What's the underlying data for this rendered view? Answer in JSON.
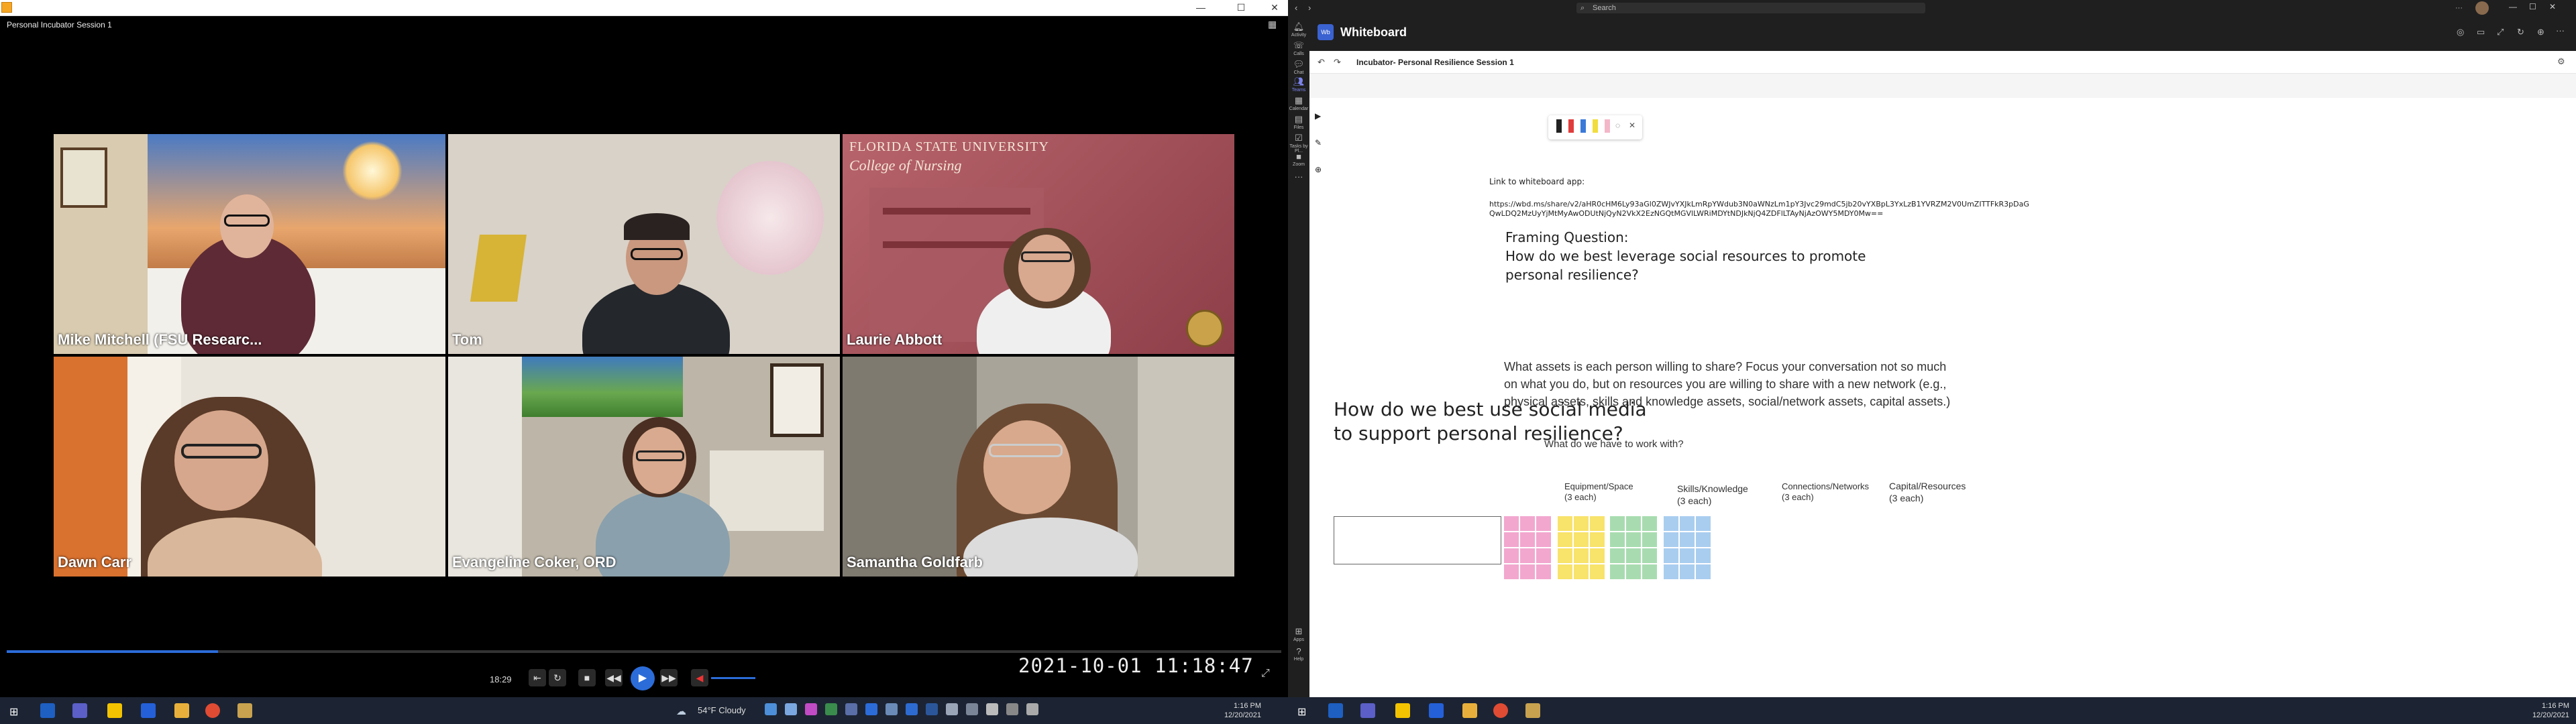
{
  "video": {
    "window_title": "Personal Incubator Session 1",
    "participants": [
      {
        "name": "Mike Mitchell (FSU Researc..."
      },
      {
        "name": "Tom"
      },
      {
        "name": "Laurie Abbott"
      },
      {
        "name": "Dawn Carr"
      },
      {
        "name": "Evangeline Coker, ORD"
      },
      {
        "name": "Samantha Goldfarb"
      }
    ],
    "fsu_banner_line1": "FLORIDA STATE UNIVERSITY",
    "fsu_banner_line2": "College of Nursing",
    "elapsed": "18:29",
    "timestamp": "2021-10-01  11:18:47",
    "progress": 0.166
  },
  "taskbar_left": {
    "weather": "54°F  Cloudy",
    "time": "1:16 PM",
    "date": "12/20/2021"
  },
  "teams": {
    "search_placeholder": "Search",
    "app_title": "Whiteboard",
    "board_title": "Incubator- Personal Resilience Session 1",
    "rail": [
      {
        "label": "Activity",
        "icon": "bell-icon"
      },
      {
        "label": "Calls",
        "icon": "phone-icon"
      },
      {
        "label": "Chat",
        "icon": "chat-icon"
      },
      {
        "label": "Teams",
        "icon": "teams-icon"
      },
      {
        "label": "Calendar",
        "icon": "calendar-icon"
      },
      {
        "label": "Files",
        "icon": "file-icon"
      },
      {
        "label": "Tasks by Pl...",
        "icon": "tasks-icon"
      },
      {
        "label": "Zoom",
        "icon": "camera-icon"
      },
      {
        "label": "Apps",
        "icon": "apps-icon"
      },
      {
        "label": "Help",
        "icon": "help-icon"
      }
    ]
  },
  "whiteboard": {
    "link_label": "Link to whiteboard app:",
    "link_url_line1": "https://wbd.ms/share/v2/aHR0cHM6Ly93aGl0ZWJvYXJkLmRpYWdub3N0aWNzLm1pY3Jvc29mdC5jb20vYXBpL3YxLzB1YVRZM2V0UmZITTFkR3pDaG",
    "link_url_line2": "QwLDQ2MzUyYjMtMyAwODUtNjQyN2VkX2EzNGQtMGVlLWRiMDYtNDJkNjQ4ZDFlLTAyNjAzOWY5MDY0Mw==",
    "framing_label": "Framing Question:",
    "framing_q1": "How do we best leverage social resources to promote",
    "framing_q2": "personal resilience?",
    "assets_line1": "What assets is each person willing to share? Focus your conversation not so much",
    "assets_line2": "on what you do, but on resources you are willing to share with a new network (e.g.,",
    "assets_line3": "physical assets, skills and knowledge assets, social/network assets, capital assets.)",
    "work_with": "What do we have to work with?",
    "social_q1": "How do we best use social media",
    "social_q2": "to support personal resilience?",
    "columns": [
      {
        "title": "Equipment/Space",
        "sub": "(3 each)",
        "color": "#f2a7cf"
      },
      {
        "title": "Skills/Knowledge",
        "sub": "(3 each)",
        "color": "#f8e36b"
      },
      {
        "title": "Connections/Networks",
        "sub": "(3 each)",
        "color": "#a8dcb0"
      },
      {
        "title": "Capital/Resources",
        "sub": "(3 each)",
        "color": "#a9cdef"
      }
    ]
  },
  "taskbar_right": {
    "time": "1:16 PM",
    "date": "12/20/2021"
  }
}
